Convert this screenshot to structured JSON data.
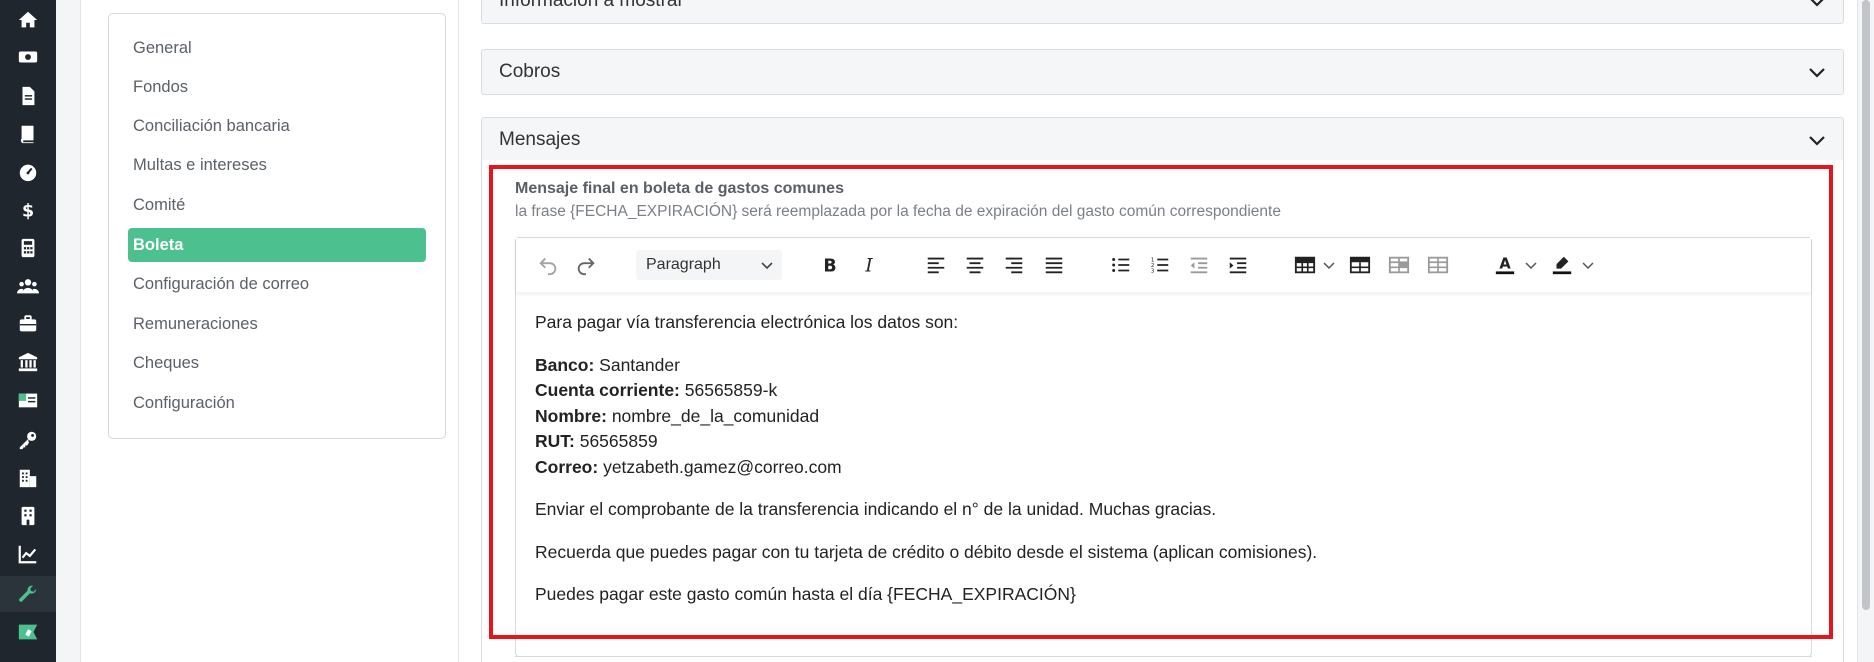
{
  "colors": {
    "rail_bg": "#1f262d",
    "active_menu": "#4cc08e",
    "highlight_border": "#e8141b",
    "accent_green": "#4cc08e"
  },
  "rail": {
    "icons": [
      "home-icon",
      "money-icon",
      "document-icon",
      "book-icon",
      "dashboard-icon",
      "dollar-icon",
      "calculator-icon",
      "users-icon",
      "briefcase-icon",
      "bank-icon",
      "id-card-icon",
      "key-icon",
      "building-icon",
      "apartment-icon",
      "chart-line-icon",
      "wrench-icon",
      "flag-rocket-icon"
    ],
    "active": "wrench-icon"
  },
  "menu": {
    "items": [
      {
        "label": "General"
      },
      {
        "label": "Fondos"
      },
      {
        "label": "Conciliación bancaria"
      },
      {
        "label": "Multas e intereses"
      },
      {
        "label": "Comité"
      },
      {
        "label": "Boleta",
        "active": true
      },
      {
        "label": "Configuración de correo"
      },
      {
        "label": "Remuneraciones"
      },
      {
        "label": "Cheques"
      },
      {
        "label": "Configuración"
      }
    ]
  },
  "accordions": {
    "info": "Información a mostrar",
    "cobros": "Cobros",
    "mensajes": "Mensajes"
  },
  "field": {
    "label": "Mensaje final en boleta de gastos comunes",
    "help": "la frase {FECHA_EXPIRACIÓN} será reemplazada por la fecha de expiración del gasto común correspondiente"
  },
  "editor": {
    "block_format": "Paragraph",
    "toolbar_icons": [
      "undo-icon",
      "redo-icon",
      "bold-icon",
      "italic-icon",
      "align-left-icon",
      "align-center-icon",
      "align-right-icon",
      "align-justify-icon",
      "bullet-list-icon",
      "numbered-list-icon",
      "outdent-icon",
      "indent-icon",
      "table-icon",
      "table-props-icon",
      "table-row-icon",
      "table-cell-icon",
      "text-color-icon",
      "highlight-color-icon"
    ],
    "content": {
      "intro": "Para pagar vía transferencia electrónica los datos son:",
      "banco_label": "Banco:",
      "banco_value": " Santander",
      "cuenta_label": "Cuenta corriente:",
      "cuenta_value": " 56565859-k",
      "nombre_label": "Nombre:",
      "nombre_value": " nombre_de_la_comunidad",
      "rut_label": "RUT:",
      "rut_value": " 56565859",
      "correo_label": "Correo:",
      "correo_value": " yetzabeth.gamez@correo.com",
      "p2": "Enviar el comprobante de la transferencia indicando el n° de la unidad. Muchas gracias.",
      "p3": "Recuerda que puedes pagar con tu tarjeta de crédito o débito desde el sistema (aplican comisiones).",
      "p4": "Puedes pagar este gasto común hasta el día {FECHA_EXPIRACIÓN}"
    }
  }
}
